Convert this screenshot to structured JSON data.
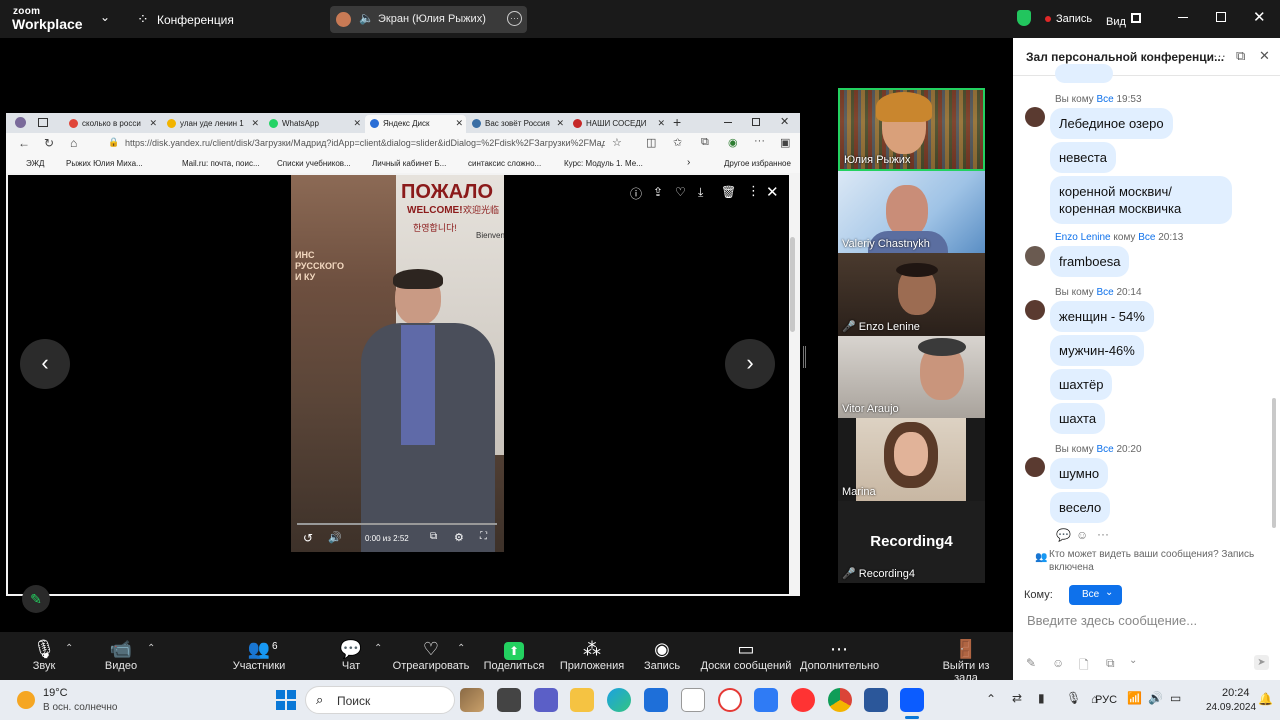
{
  "zoom": {
    "logo_small": "zoom",
    "logo_big": "Workplace",
    "meeting_label": "Конференция",
    "share_label": "Экран (Юлия Рыжих)",
    "record_label": "Запись",
    "view_label": "Вид"
  },
  "browser": {
    "tabs": [
      {
        "label": "сколько в росси",
        "color": "#e0463a"
      },
      {
        "label": "улан уде ленин 1",
        "color": "#f2b400"
      },
      {
        "label": "WhatsApp",
        "color": "#25d366"
      },
      {
        "label": "Яндекс Диск",
        "color": "#2a6ed6"
      },
      {
        "label": "Вас зовёт Россия",
        "color": "#3a6ea5"
      },
      {
        "label": "НАШИ СОСЕДИ",
        "color": "#c62828"
      }
    ],
    "url": "https://disk.yandex.ru/client/disk/Загрузки/Мадрид?idApp=client&dialog=slider&idDialog=%2Fdisk%2FЗагрузки%2FМад...",
    "favorites": [
      "ЭЖД",
      "Рыжих Юлия Миха...",
      "Mail.ru: почта, поис...",
      "Списки учебников...",
      "Личный кабинет Б...",
      "синтаксис сложно...",
      "Курс: Модуль 1. Ме..."
    ],
    "other_favorites": "Другое избранное",
    "video_time": "0:00 из 2:52",
    "photo_sign_top": "ПОЖАЛО",
    "photo_sign_welcome": "WELCOME!",
    "photo_sign_korean": "한영합니다!",
    "photo_sign_chinese": "欢迎光临",
    "photo_sign_bienvenue": "Bienven",
    "photo_sign_left": "ИНС\nРУССКОГО\nИ КУ"
  },
  "participants": [
    {
      "name": "Юлия Рыжих"
    },
    {
      "name": "Valeriy Chastnykh"
    },
    {
      "name": "Enzo Lenine"
    },
    {
      "name": "Vitor Araujo"
    },
    {
      "name": "Marina"
    },
    {
      "name": "Recording4",
      "title": "Recording4"
    }
  ],
  "chat": {
    "title": "Зал персональной конференци...",
    "groups": [
      {
        "sender": "Вы",
        "to_word": "кому",
        "to": "Все",
        "time": "19:53",
        "messages": [
          "Лебединое озеро",
          "невеста",
          "коренной москвич/ коренная москвичка"
        ]
      },
      {
        "sender": "Enzo Lenine",
        "to_word": "кому",
        "to": "Все",
        "time": "20:13",
        "messages": [
          "framboesa"
        ]
      },
      {
        "sender": "Вы",
        "to_word": "кому",
        "to": "Все",
        "time": "20:14",
        "messages": [
          "женщин - 54%",
          "мужчин-46%",
          "шахтёр",
          "шахта"
        ]
      },
      {
        "sender": "Вы",
        "to_word": "кому",
        "to": "Все",
        "time": "20:20",
        "messages": [
          "шумно",
          "весело"
        ]
      }
    ],
    "visibility_note": "Кто может видеть ваши сообщения? Запись включена",
    "to_label": "Кому:",
    "to_value": "Все",
    "input_placeholder": "Введите здесь сообщение..."
  },
  "toolbar": {
    "audio": "Звук",
    "video": "Видео",
    "participants": "Участники",
    "participants_count": "6",
    "chat": "Чат",
    "react": "Отреагировать",
    "share": "Поделиться",
    "apps": "Приложения",
    "record": "Запись",
    "whiteboards": "Доски сообщений",
    "more": "Дополнительно",
    "leave": "Выйти из зала"
  },
  "taskbar": {
    "temp": "19°C",
    "weather": "В осн. солнечно",
    "search": "Поиск",
    "lang": "РУС",
    "time": "20:24",
    "date": "24.09.2024"
  },
  "colors": {
    "accent": "#0e71eb",
    "share_green": "#22c55e",
    "record_red": "#e02828",
    "chat_bubble": "#e1efff"
  }
}
